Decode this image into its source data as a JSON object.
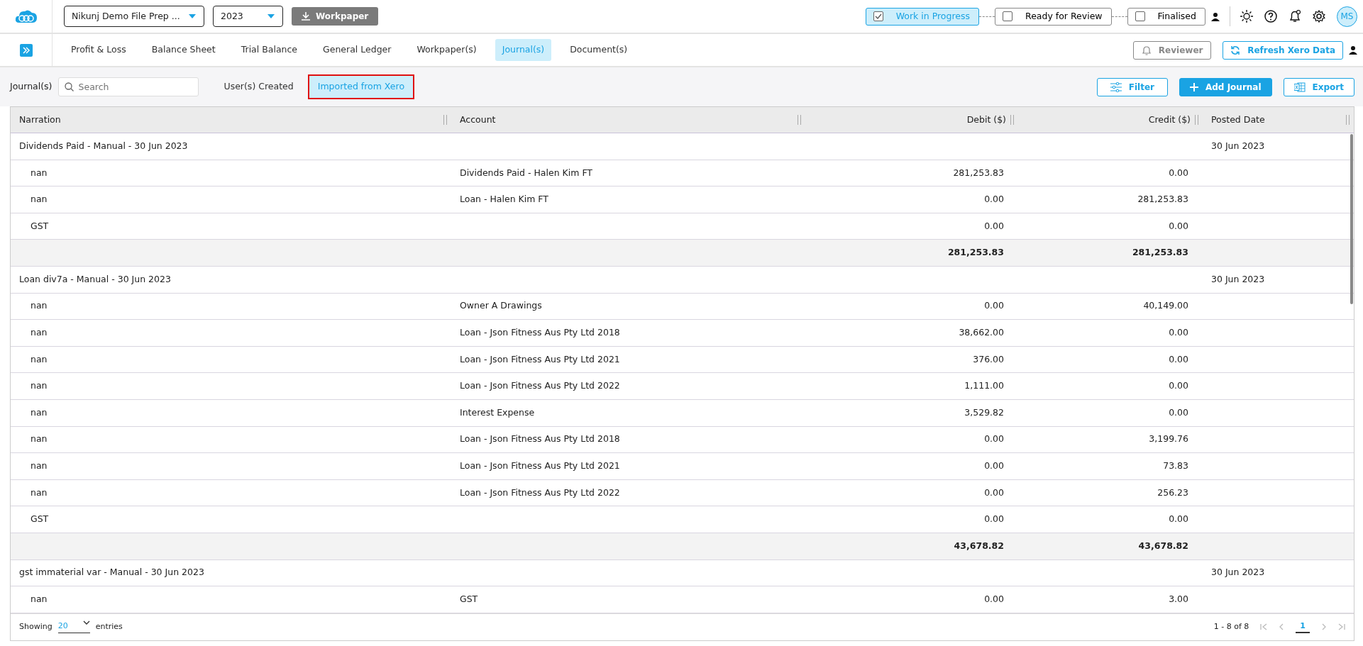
{
  "header": {
    "client_select": "Nikunj Demo File Prep ...",
    "year_select": "2023",
    "workpaper_button": "Workpaper",
    "status_steps": [
      {
        "label": "Work in Progress",
        "checked": true
      },
      {
        "label": "Ready for Review",
        "checked": false
      },
      {
        "label": "Finalised",
        "checked": false
      }
    ],
    "avatar": "MS"
  },
  "nav": {
    "tabs": [
      {
        "label": "Profit & Loss",
        "selected": false
      },
      {
        "label": "Balance Sheet",
        "selected": false
      },
      {
        "label": "Trial Balance",
        "selected": false
      },
      {
        "label": "General Ledger",
        "selected": false
      },
      {
        "label": "Workpaper(s)",
        "selected": false
      },
      {
        "label": "Journal(s)",
        "selected": true
      },
      {
        "label": "Document(s)",
        "selected": false
      }
    ],
    "reviewer_button": "Reviewer",
    "refresh_button": "Refresh Xero Data"
  },
  "toolbar": {
    "label": "Journal(s)",
    "search": {
      "placeholder": "Search"
    },
    "subtabs": [
      {
        "label": "User(s) Created",
        "selected": false,
        "highlighted": false
      },
      {
        "label": "Imported from Xero",
        "selected": true,
        "highlighted": true
      }
    ],
    "buttons": [
      {
        "kind": "filter",
        "label": "Filter"
      },
      {
        "kind": "add",
        "label": "Add Journal"
      },
      {
        "kind": "export",
        "label": "Export"
      }
    ]
  },
  "table": {
    "columns": [
      "Narration",
      "Account",
      "Debit ($)",
      "Credit ($)",
      "Posted Date"
    ],
    "journals": [
      {
        "title": "Dividends Paid - Manual - 30 Jun 2023",
        "posted_date": "30 Jun 2023",
        "lines": [
          {
            "narration": "nan",
            "account": "Dividends Paid - Halen Kim FT",
            "debit": "281,253.83",
            "credit": "0.00"
          },
          {
            "narration": "nan",
            "account": "Loan - Halen Kim FT",
            "debit": "0.00",
            "credit": "281,253.83"
          },
          {
            "narration": "GST",
            "debit": "0.00",
            "credit": "0.00"
          }
        ],
        "total_debit": "281,253.83",
        "total_credit": "281,253.83"
      },
      {
        "title": "Loan div7a - Manual - 30 Jun 2023",
        "posted_date": "30 Jun 2023",
        "lines": [
          {
            "narration": "nan",
            "account": "Owner A Drawings",
            "debit": "0.00",
            "credit": "40,149.00"
          },
          {
            "narration": "nan",
            "account": "Loan - Json Fitness Aus Pty Ltd 2018",
            "debit": "38,662.00",
            "credit": "0.00"
          },
          {
            "narration": "nan",
            "account": "Loan - Json Fitness Aus Pty Ltd 2021",
            "debit": "376.00",
            "credit": "0.00"
          },
          {
            "narration": "nan",
            "account": "Loan - Json Fitness Aus Pty Ltd 2022",
            "debit": "1,111.00",
            "credit": "0.00"
          },
          {
            "narration": "nan",
            "account": "Interest Expense",
            "debit": "3,529.82",
            "credit": "0.00"
          },
          {
            "narration": "nan",
            "account": "Loan - Json Fitness Aus Pty Ltd 2018",
            "debit": "0.00",
            "credit": "3,199.76"
          },
          {
            "narration": "nan",
            "account": "Loan - Json Fitness Aus Pty Ltd 2021",
            "debit": "0.00",
            "credit": "73.83"
          },
          {
            "narration": "nan",
            "account": "Loan - Json Fitness Aus Pty Ltd 2022",
            "debit": "0.00",
            "credit": "256.23"
          },
          {
            "narration": "GST",
            "debit": "0.00",
            "credit": "0.00"
          }
        ],
        "total_debit": "43,678.82",
        "total_credit": "43,678.82"
      },
      {
        "title": "gst immaterial var - Manual - 30 Jun 2023",
        "posted_date": "30 Jun 2023",
        "lines": [
          {
            "narration": "nan",
            "account": "GST",
            "debit": "0.00",
            "credit": "3.00"
          }
        ]
      }
    ]
  },
  "footer": {
    "showing": "Showing",
    "page_size": "20",
    "entries": "entries",
    "range": "1 - 8 of 8",
    "current_page": "1"
  }
}
